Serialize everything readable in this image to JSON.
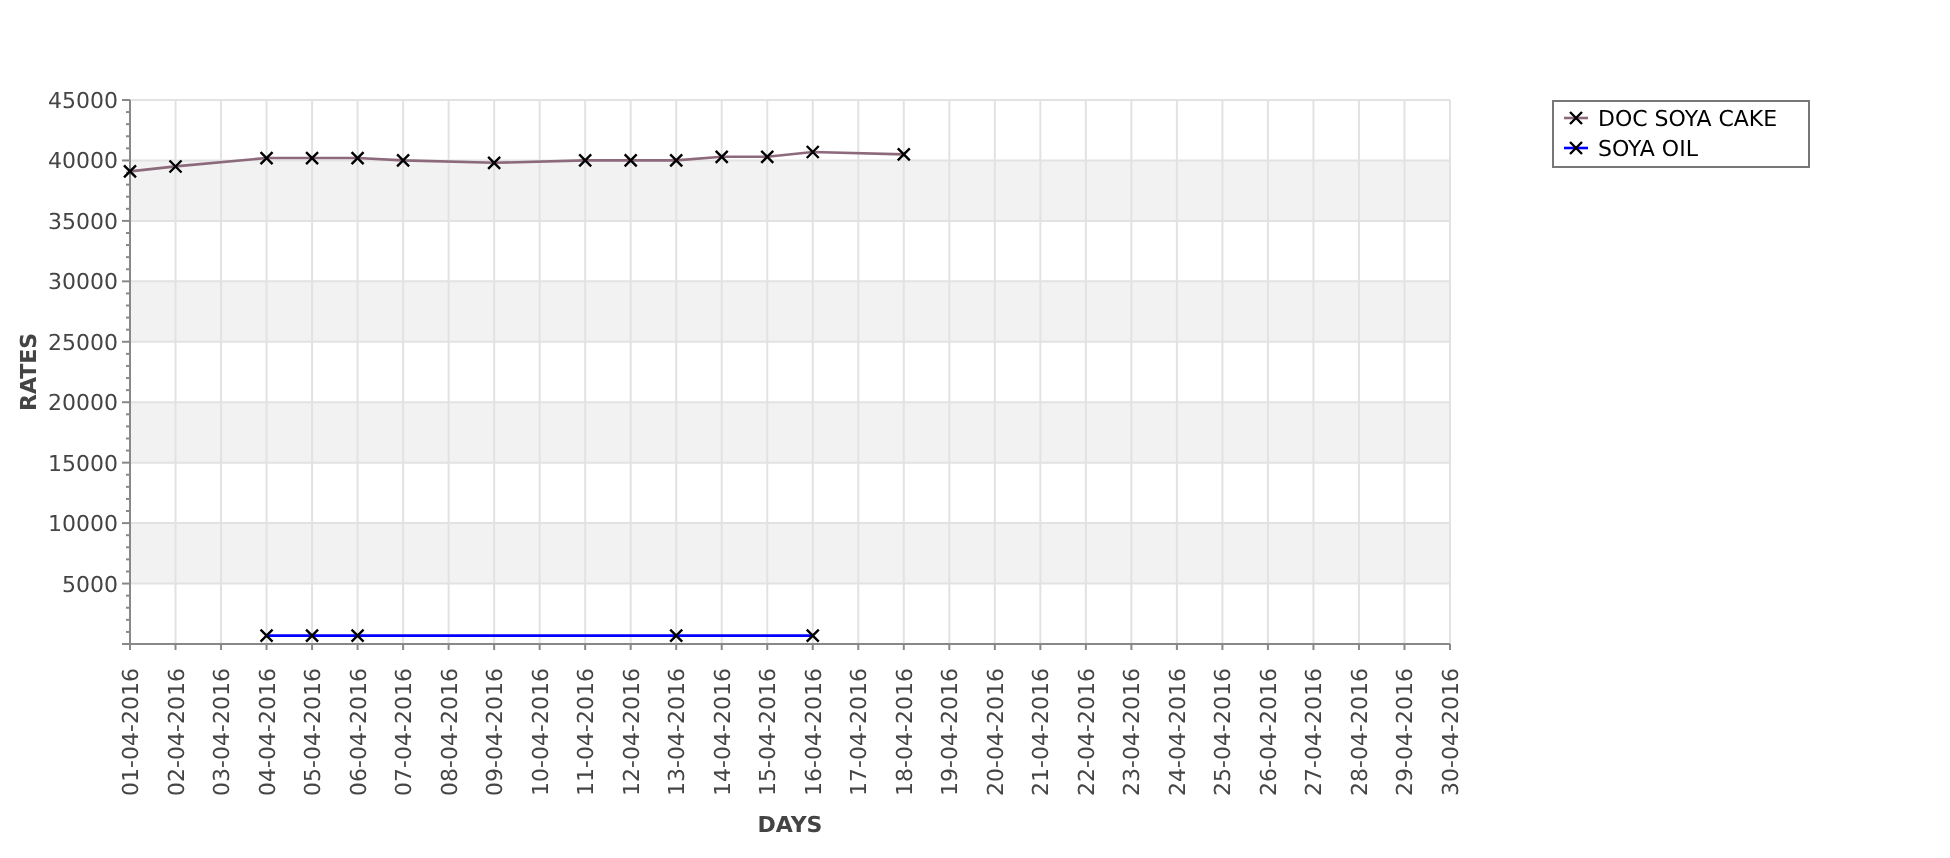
{
  "chart": {
    "chart_data": {
      "type": "line",
      "xlabel": "DAYS",
      "ylabel": "RATES",
      "categories": [
        "01-04-2016",
        "02-04-2016",
        "03-04-2016",
        "04-04-2016",
        "05-04-2016",
        "06-04-2016",
        "07-04-2016",
        "08-04-2016",
        "09-04-2016",
        "10-04-2016",
        "11-04-2016",
        "12-04-2016",
        "13-04-2016",
        "14-04-2016",
        "15-04-2016",
        "16-04-2016",
        "17-04-2016",
        "18-04-2016",
        "19-04-2016",
        "20-04-2016",
        "21-04-2016",
        "22-04-2016",
        "23-04-2016",
        "24-04-2016",
        "25-04-2016",
        "26-04-2016",
        "27-04-2016",
        "28-04-2016",
        "29-04-2016",
        "30-04-2016"
      ],
      "series": [
        {
          "name": "DOC SOYA CAKE",
          "color": "#8c6a7c",
          "marker": "x",
          "values": [
            39100,
            39500,
            null,
            40200,
            40200,
            40200,
            40000,
            null,
            39800,
            null,
            40000,
            40000,
            40000,
            40300,
            40300,
            40700,
            null,
            40500,
            null,
            null,
            null,
            null,
            null,
            null,
            null,
            null,
            null,
            null,
            null,
            null
          ]
        },
        {
          "name": "SOYA OIL",
          "color": "#0000ff",
          "marker": "x",
          "values": [
            null,
            null,
            null,
            700,
            700,
            700,
            null,
            null,
            null,
            null,
            null,
            null,
            700,
            null,
            null,
            700,
            null,
            null,
            null,
            null,
            null,
            null,
            null,
            null,
            null,
            null,
            null,
            null,
            null,
            null
          ]
        }
      ],
      "grid": true,
      "legend": true,
      "ylim": [
        0,
        45000
      ],
      "yticks": [
        5000,
        10000,
        15000,
        20000,
        25000,
        30000,
        35000,
        40000,
        45000
      ]
    }
  }
}
